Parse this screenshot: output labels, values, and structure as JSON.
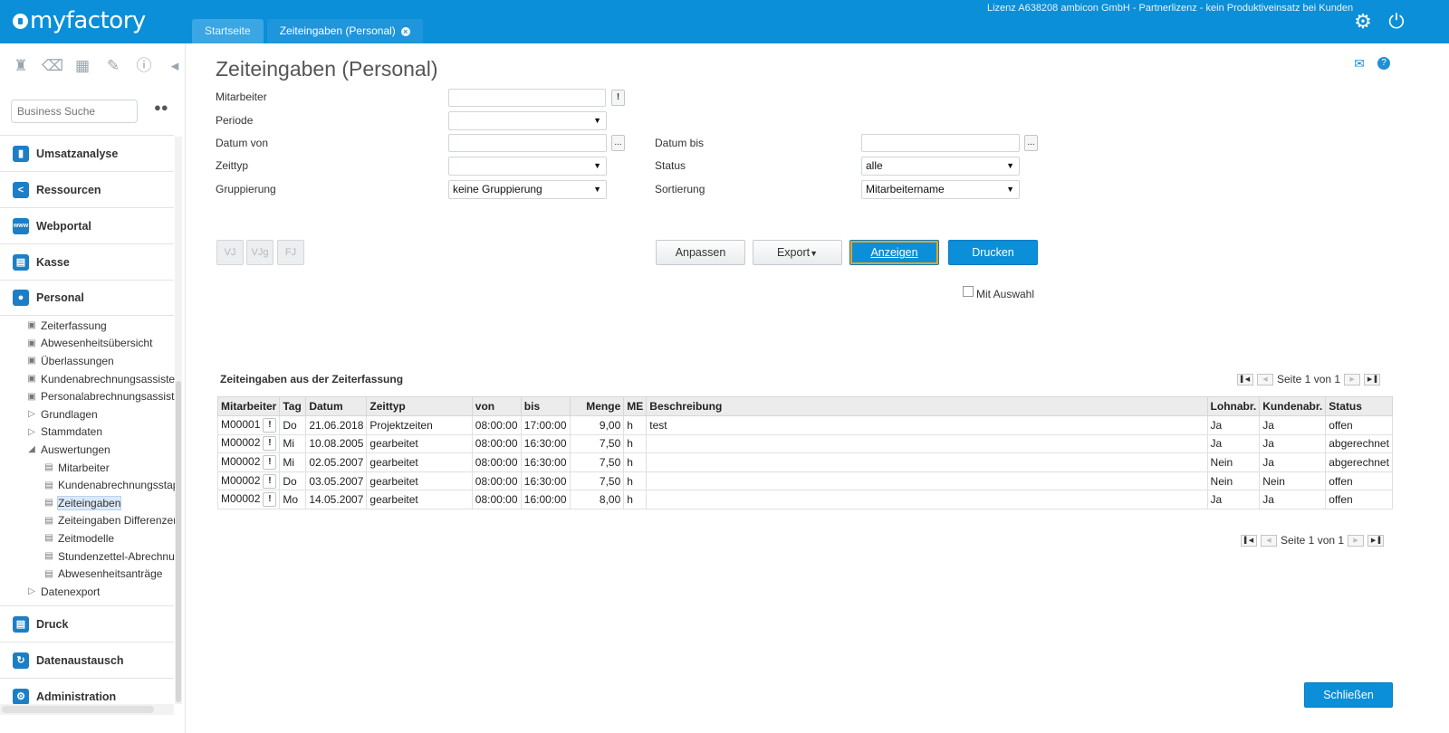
{
  "header": {
    "logo_text": "myfactory",
    "license": "Lizenz A638208 ambicon GmbH - Partnerlizenz - kein Produktiveinsatz bei Kunden",
    "tabs": [
      {
        "label": "Startseite"
      },
      {
        "label": "Zeiteingaben (Personal)"
      }
    ],
    "settings_icon": "gear-icon",
    "power_icon": "power-icon"
  },
  "sidebar": {
    "search_placeholder": "Business Suche",
    "sections_top": [
      {
        "label": "Umsatzanalyse",
        "icon": "bar-chart-icon"
      },
      {
        "label": "Ressourcen",
        "icon": "share-icon"
      },
      {
        "label": "Webportal",
        "icon": "www-icon"
      },
      {
        "label": "Kasse",
        "icon": "printer-icon"
      },
      {
        "label": "Personal",
        "icon": "people-icon"
      }
    ],
    "tree": [
      {
        "label": "Zeiterfassung",
        "level": 1,
        "type": "form"
      },
      {
        "label": "Abwesenheitsübersicht",
        "level": 1,
        "type": "form"
      },
      {
        "label": "Überlassungen",
        "level": 1,
        "type": "form"
      },
      {
        "label": "Kundenabrechnungsassistent",
        "level": 1,
        "type": "form"
      },
      {
        "label": "Personalabrechnungsassistent",
        "level": 1,
        "type": "form"
      },
      {
        "label": "Grundlagen",
        "level": 1,
        "type": "collapsed"
      },
      {
        "label": "Stammdaten",
        "level": 1,
        "type": "collapsed"
      },
      {
        "label": "Auswertungen",
        "level": 1,
        "type": "expanded"
      },
      {
        "label": "Mitarbeiter",
        "level": 2,
        "type": "report"
      },
      {
        "label": "Kundenabrechnungsstapel",
        "level": 2,
        "type": "report"
      },
      {
        "label": "Zeiteingaben",
        "level": 2,
        "type": "report",
        "selected": true
      },
      {
        "label": "Zeiteingaben Differenzen",
        "level": 2,
        "type": "report"
      },
      {
        "label": "Zeitmodelle",
        "level": 2,
        "type": "report"
      },
      {
        "label": "Stundenzettel-Abrechnung",
        "level": 2,
        "type": "report"
      },
      {
        "label": "Abwesenheitsanträge",
        "level": 2,
        "type": "report"
      },
      {
        "label": "Datenexport",
        "level": 1,
        "type": "collapsed"
      }
    ],
    "sections_bottom": [
      {
        "label": "Druck",
        "icon": "printer-icon"
      },
      {
        "label": "Datenaustausch",
        "icon": "sync-icon"
      },
      {
        "label": "Administration",
        "icon": "gear-icon"
      }
    ]
  },
  "main": {
    "title": "Zeiteingaben (Personal)",
    "form": {
      "mitarbeiter_label": "Mitarbeiter",
      "mitarbeiter_value": "",
      "periode_label": "Periode",
      "periode_value": "",
      "datum_von_label": "Datum von",
      "datum_von_value": "",
      "datum_bis_label": "Datum bis",
      "datum_bis_value": "",
      "zeittyp_label": "Zeittyp",
      "zeittyp_value": "",
      "status_label": "Status",
      "status_value": "alle",
      "gruppierung_label": "Gruppierung",
      "gruppierung_value": "keine Gruppierung",
      "sortierung_label": "Sortierung",
      "sortierung_value": "Mitarbeitername"
    },
    "period_buttons": [
      "VJ",
      "VJg",
      "FJ"
    ],
    "buttons": {
      "anpassen": "Anpassen",
      "export": "Export",
      "anzeigen": "Anzeigen",
      "drucken": "Drucken"
    },
    "mit_auswahl_label": "Mit Auswahl",
    "grid": {
      "title": "Zeiteingaben aus der Zeiterfassung",
      "pager_text": "Seite 1 von 1",
      "columns": [
        "Mitarbeiter",
        "Tag",
        "Datum",
        "Zeittyp",
        "von",
        "bis",
        "Menge",
        "ME",
        "Beschreibung",
        "Lohnabr.",
        "Kundenabr.",
        "Status"
      ],
      "rows": [
        [
          "M00001",
          "Do",
          "21.06.2018",
          "Projektzeiten",
          "08:00:00",
          "17:00:00",
          "9,00",
          "h",
          "test",
          "Ja",
          "Ja",
          "offen"
        ],
        [
          "M00002",
          "Mi",
          "10.08.2005",
          "gearbeitet",
          "08:00:00",
          "16:30:00",
          "7,50",
          "h",
          "",
          "Ja",
          "Ja",
          "abgerechnet"
        ],
        [
          "M00002",
          "Mi",
          "02.05.2007",
          "gearbeitet",
          "08:00:00",
          "16:30:00",
          "7,50",
          "h",
          "",
          "Nein",
          "Ja",
          "abgerechnet"
        ],
        [
          "M00002",
          "Do",
          "03.05.2007",
          "gearbeitet",
          "08:00:00",
          "16:30:00",
          "7,50",
          "h",
          "",
          "Nein",
          "Nein",
          "offen"
        ],
        [
          "M00002",
          "Mo",
          "14.05.2007",
          "gearbeitet",
          "08:00:00",
          "16:00:00",
          "8,00",
          "h",
          "",
          "Ja",
          "Ja",
          "offen"
        ]
      ]
    },
    "close_button": "Schließen"
  }
}
